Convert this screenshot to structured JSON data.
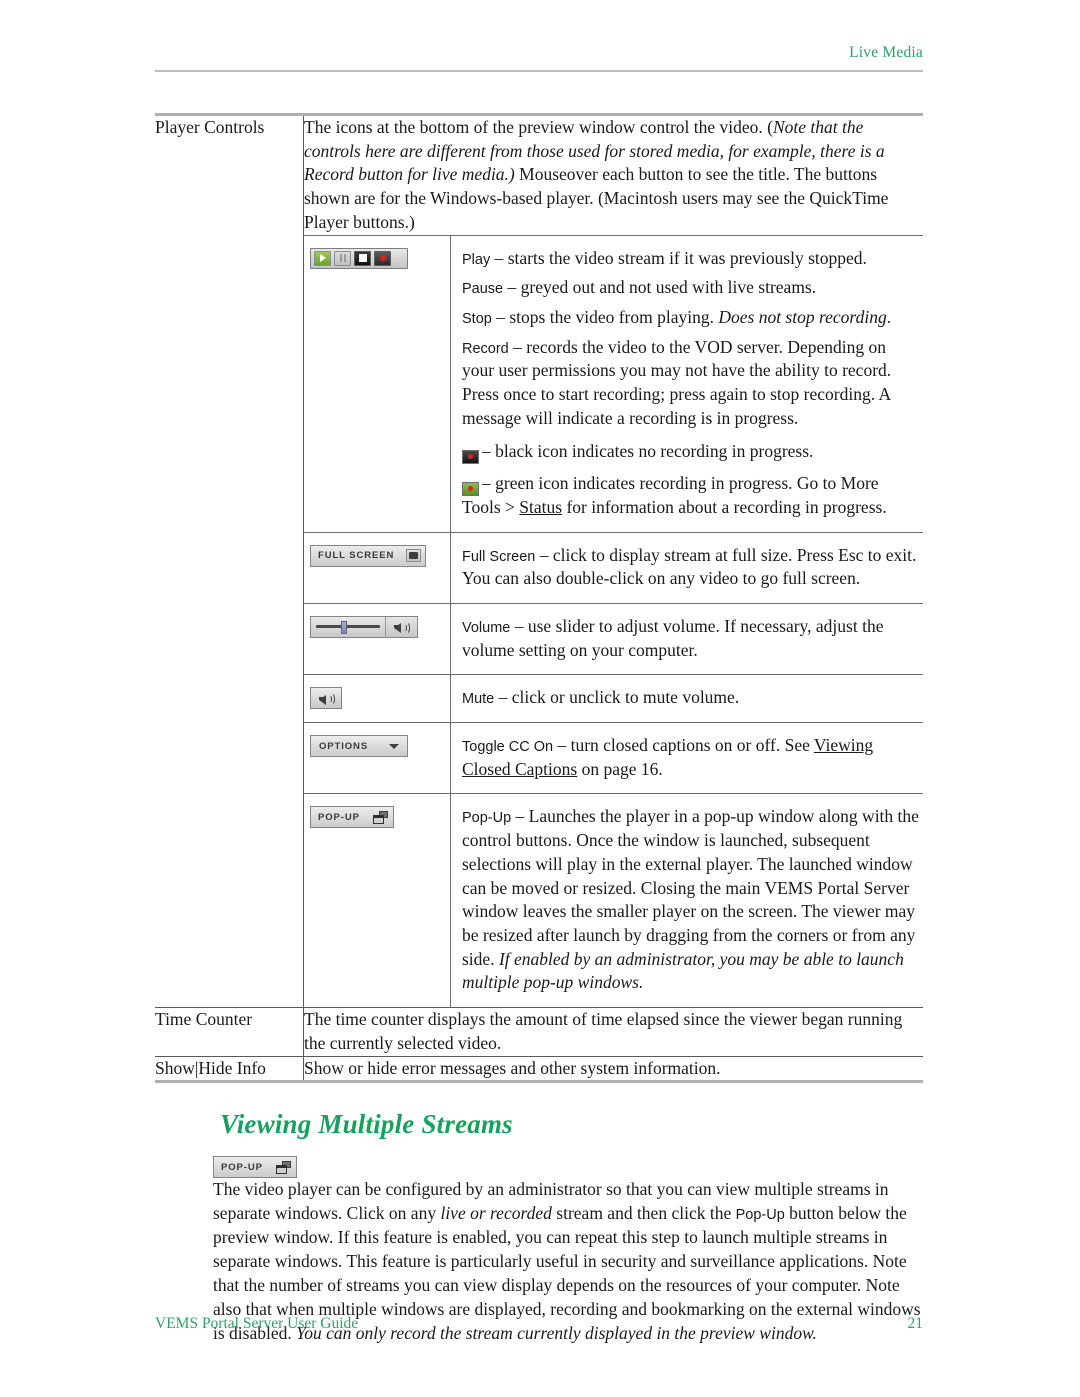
{
  "header": {
    "running_head": "Live Media"
  },
  "table": {
    "rows": [
      {
        "label": "Player Controls",
        "intro": {
          "part1": "The icons at the bottom of the preview window control the video. (",
          "italic1": "Note that the controls here are different from those used for stored media, for example, there is a Record button for live media.)",
          "part2": " Mouseover each button to see the title. The buttons shown are for the Windows-based player. (Macintosh users may see the QuickTime Player buttons.)"
        },
        "icon_rows": [
          {
            "icon": "transport-bar",
            "icon_buttons": [
              "play",
              "pause",
              "stop",
              "record"
            ],
            "lines": [
              {
                "label": "Play",
                "text": " – starts the video stream if it was previously stopped."
              },
              {
                "label": "Pause",
                "text": " – greyed out and not used with live streams."
              },
              {
                "label": "Stop",
                "text": " – stops the video from playing. ",
                "italic": "Does not stop recording",
                "tail": "."
              },
              {
                "label": "Record",
                "text": " – records the video to the VOD server. Depending on your user permissions you may not have the ability to record. Press once to start recording; press again to stop recording. A message will indicate a recording is in progress."
              }
            ],
            "notes": [
              {
                "icon": "record-black-icon",
                "text": "– black icon indicates no recording in progress."
              },
              {
                "icon": "record-green-icon",
                "pre": "– green icon indicates recording in progress. Go to More Tools > ",
                "link": "Status",
                "post": " for information about a recording in progress."
              }
            ]
          },
          {
            "icon": "full-screen-button",
            "icon_label": "FULL SCREEN",
            "label": "Full Screen",
            "text": " – click to display stream at full size. Press Esc to exit. You can also double-click on any video to go full screen."
          },
          {
            "icon": "volume-slider",
            "label": "Volume",
            "text": " – use slider to adjust volume. If necessary, adjust the volume setting on your computer."
          },
          {
            "icon": "mute-button",
            "label": "Mute",
            "text": " – click or unclick to mute volume."
          },
          {
            "icon": "options-button",
            "icon_label": "OPTIONS",
            "label": "Toggle CC On",
            "text": " – turn closed captions on or off. See ",
            "link": "Viewing Closed Captions",
            "tail": " on page 16."
          },
          {
            "icon": "pop-up-button",
            "icon_label": "POP-UP",
            "label": "Pop-Up",
            "text": " – Launches the player in a pop-up window along with the control buttons. Once the window is launched, subsequent selections will play in the external player. The launched window can be moved or resized. Closing the main VEMS Portal Server window leaves the smaller player on the screen. The viewer may be resized after launch by dragging from the corners or from any side. ",
            "italic": "If enabled by an administrator, you may be able to launch multiple pop-up windows."
          }
        ]
      },
      {
        "label": "Time Counter",
        "text": "The time counter displays the amount of time elapsed since the viewer began running the currently selected video."
      },
      {
        "label": "Show|Hide Info",
        "text": "Show or hide error messages and other system information."
      }
    ]
  },
  "section": {
    "heading": "Viewing Multiple Streams",
    "icon": "pop-up-button",
    "icon_label": "POP-UP",
    "paragraph": {
      "p1": "The video player can be configured by an administrator so that you can view multiple streams in separate windows. Click on any ",
      "i1": "live or recorded",
      "p2": " stream and then click the ",
      "ui1": "Pop-Up",
      "p3": " button below the preview window. If this feature is enabled, you can repeat this step to launch multiple streams in separate windows. This feature is particularly useful in security and surveillance applications. Note that the number of streams you can view display depends on the resources of your computer. Note also that when multiple windows are displayed, recording and bookmarking on the external windows is disabled. ",
      "i2": "You can only record the stream currently displayed in the preview window."
    }
  },
  "footer": {
    "doc_title": "VEMS Portal Server User Guide",
    "page_number": "21"
  },
  "colors": {
    "accent_green": "#2e9e6b",
    "heading_green": "#17a05e",
    "rule_grey": "#b0b0b0"
  }
}
